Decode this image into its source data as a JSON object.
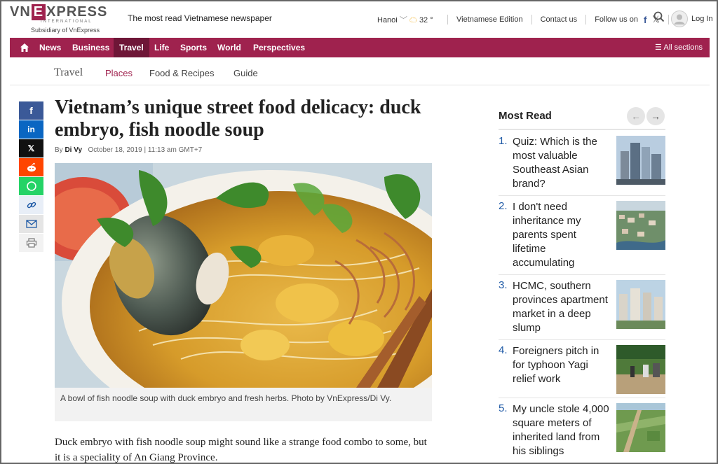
{
  "header": {
    "logo_prefix": "VN",
    "logo_letter": "E",
    "logo_suffix": "XPRESS",
    "logo_sub_brand": "INTERNATIONAL",
    "subsidiary": "Subsidiary of VnExpress",
    "tagline": "The most read Vietnamese newspaper",
    "city": "Hanoi",
    "temperature": "32 °",
    "edition": "Vietnamese Edition",
    "contact": "Contact us",
    "follow": "Follow us on",
    "login": "Log In"
  },
  "nav": {
    "items": [
      "News",
      "Business",
      "Travel",
      "Life",
      "Sports",
      "World",
      "Perspectives"
    ],
    "active": "Travel",
    "all_sections": "All sections"
  },
  "subnav": {
    "title": "Travel",
    "items": [
      "Places",
      "Food & Recipes",
      "Guide"
    ],
    "active": "Places"
  },
  "article": {
    "title": "Vietnam’s unique street food delicacy: duck embryo, fish noodle soup",
    "by": "By",
    "author": "Di Vy",
    "date": "October 18, 2019 | 11:13 am GMT+7",
    "caption": "A bowl of fish noodle soup with duck embryo and fresh herbs. Photo by VnExpress/Di Vy.",
    "lead": "Duck embryo with fish noodle soup might sound like a strange food combo to some, but it is a speciality of An Giang Province."
  },
  "most_read": {
    "title": "Most Read",
    "items": [
      {
        "num": "1.",
        "text": "Quiz: Which is the most valuable Southeast Asian brand?"
      },
      {
        "num": "2.",
        "text": "I don't need inheritance my parents spent lifetime accumulating"
      },
      {
        "num": "3.",
        "text": "HCMC, southern provinces apartment market in a deep slump"
      },
      {
        "num": "4.",
        "text": "Foreigners pitch in for typhoon Yagi relief work"
      },
      {
        "num": "5.",
        "text": "My uncle stole 4,000 square meters of inherited land from his siblings"
      }
    ]
  },
  "share": [
    "facebook-icon",
    "linkedin-icon",
    "x-icon",
    "reddit-icon",
    "whatsapp-icon",
    "link-icon",
    "mail-icon",
    "print-icon"
  ],
  "colors": {
    "brand": "#9f224e",
    "brand_dark": "#6e1637",
    "link_blue": "#1f5aa6"
  }
}
